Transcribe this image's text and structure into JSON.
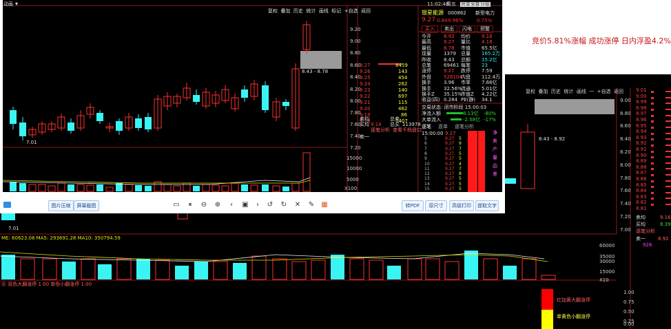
{
  "note_text": "竞价5.81%涨幅  成功涨停  日内浮盈4.2%",
  "bg_chart": {
    "toolbar": [
      "复权",
      "叠加",
      "历史",
      "统计",
      "画线",
      "一",
      "+自选",
      "返回"
    ],
    "prices": [
      "9.01",
      "9.00",
      "8.99",
      "8.98",
      "8.97",
      "8.96",
      "8.95",
      "8.94",
      "8.93",
      "8.92",
      "8.91",
      "8.90",
      "8.89",
      "8.88",
      "8.87",
      "8.86",
      "8.85",
      "8.84",
      "8.83",
      "8.82",
      "8.81"
    ],
    "axis": [
      "9.00",
      "8.80",
      "8.60",
      "8.40",
      "8.20",
      "8.00",
      "7.80",
      "7.60",
      "7.40",
      "7.20",
      "7.00"
    ],
    "range_label": "8.43 - 8.92",
    "low_label": "7.01",
    "ma_line": "ME: 60623.08  MA5: 293691.28  MA10: 350794.59",
    "vol_axis": [
      "60000",
      "35000",
      "30000",
      "15000"
    ],
    "x10": "X10",
    "ind_axis": [
      "1.00",
      "0.75",
      "0.50",
      "0.25",
      "0.00"
    ],
    "ind_line": "示  双色大翻涨停  1.00  单色小翻涨停  1.00",
    "legend_red": "红加黄大翻涨停",
    "legend_yellow": "单黄色小翻涨停",
    "right_labels": [
      "卖均",
      "买均",
      "逐笔分析",
      "卖一"
    ],
    "right_values": [
      "9.16",
      "8.39",
      "8.92",
      "928"
    ]
  },
  "window": {
    "title": "动画",
    "controls": [
      "11:02:48",
      "周五",
      "资金",
      "全部",
      "分组"
    ],
    "toolbar": [
      "复权",
      "叠加",
      "历史",
      "统计",
      "画线",
      "标记",
      "+自选",
      "返回"
    ],
    "axis": [
      "9.20",
      "9.00",
      "8.80",
      "8.60",
      "8.40",
      "8.20",
      "8.00",
      "7.80",
      "7.60",
      "7.40",
      "7.20"
    ],
    "range_label": "8.43 - 8.78",
    "low_label": "7.01",
    "vol_axis": [
      "15000",
      "10000",
      "5000"
    ],
    "x100": "X100",
    "stock_name": "银星能源",
    "stock_code": "000862",
    "stock_sector": "新型电力",
    "stock_price": "9.27",
    "stock_change": "0.84",
    "stock_pct": "9.96%",
    "stock_extra": "0.75%",
    "action_buttons": [
      "买入",
      "卖出",
      "闪电",
      "预警"
    ],
    "info": [
      [
        "今开",
        "8.92",
        "均价",
        "9.16"
      ],
      [
        "最高",
        "9.27",
        "量比",
        "4.18"
      ],
      [
        "最低",
        "8.78",
        "市值",
        "65.5亿"
      ],
      [
        "现量",
        "1379",
        "总量",
        "165.2万"
      ],
      [
        "昨收",
        "8.43",
        "总额",
        "15.2亿"
      ],
      [
        "总笔",
        "69461",
        "每笔",
        "23"
      ],
      [
        "涨停",
        "9.27",
        "跌停",
        "7.59"
      ],
      [
        "外盘",
        "528104",
        "内盘",
        "112.4万"
      ],
      [
        "换手",
        "3.96",
        "市率",
        "7.66亿"
      ],
      [
        "换手",
        "32.56%",
        "流通",
        "5.01亿"
      ],
      [
        "换手Z",
        "35.15%",
        "市值Z",
        "4.22亿"
      ],
      [
        "收益(四)",
        "0.284",
        "PE(静)",
        "34.1"
      ]
    ],
    "trade_status": "交易状态: 闭市阶段  15:00:03",
    "flows": [
      [
        "净流入额",
        "6.13亿",
        "-80%"
      ],
      [
        "大单流入",
        "-2.58亿",
        "-17%"
      ]
    ],
    "flow_tabs": [
      "逐笔",
      "逐单",
      "逐笔分析"
    ],
    "book_prices": [
      "9.27",
      "9.26",
      "9.25",
      "9.24",
      "9.23",
      "9.22",
      "9.21",
      "9.20",
      "9.19",
      "9.18"
    ],
    "book_vols": [
      "8459",
      "143",
      "454",
      "262",
      "140",
      "697",
      "115",
      "462",
      "86",
      "1407"
    ],
    "book_extra": [
      "卖均",
      "总卖",
      "买均",
      "9.14",
      "总买",
      "113978"
    ],
    "book_links": [
      "逐笔分析",
      "查看千档盘口"
    ],
    "book_bottom": "卖一",
    "tick_time": "15:00:00",
    "tick_price": "9.27",
    "side_labels": [
      "净",
      "卖",
      "产",
      "量",
      "品",
      "差"
    ]
  },
  "toolbar": {
    "btn_compress": "图片压缩",
    "btn_screenshot": "屏幕截图",
    "btn_pdf": "转PDF",
    "btn_size": "原尺寸",
    "btn_print": "高级打印",
    "btn_ocr": "提取文字"
  },
  "colors": {
    "up": "#ff2b2b",
    "down": "#3af4f4",
    "bg": "#000000",
    "accent": "#c7141a"
  }
}
